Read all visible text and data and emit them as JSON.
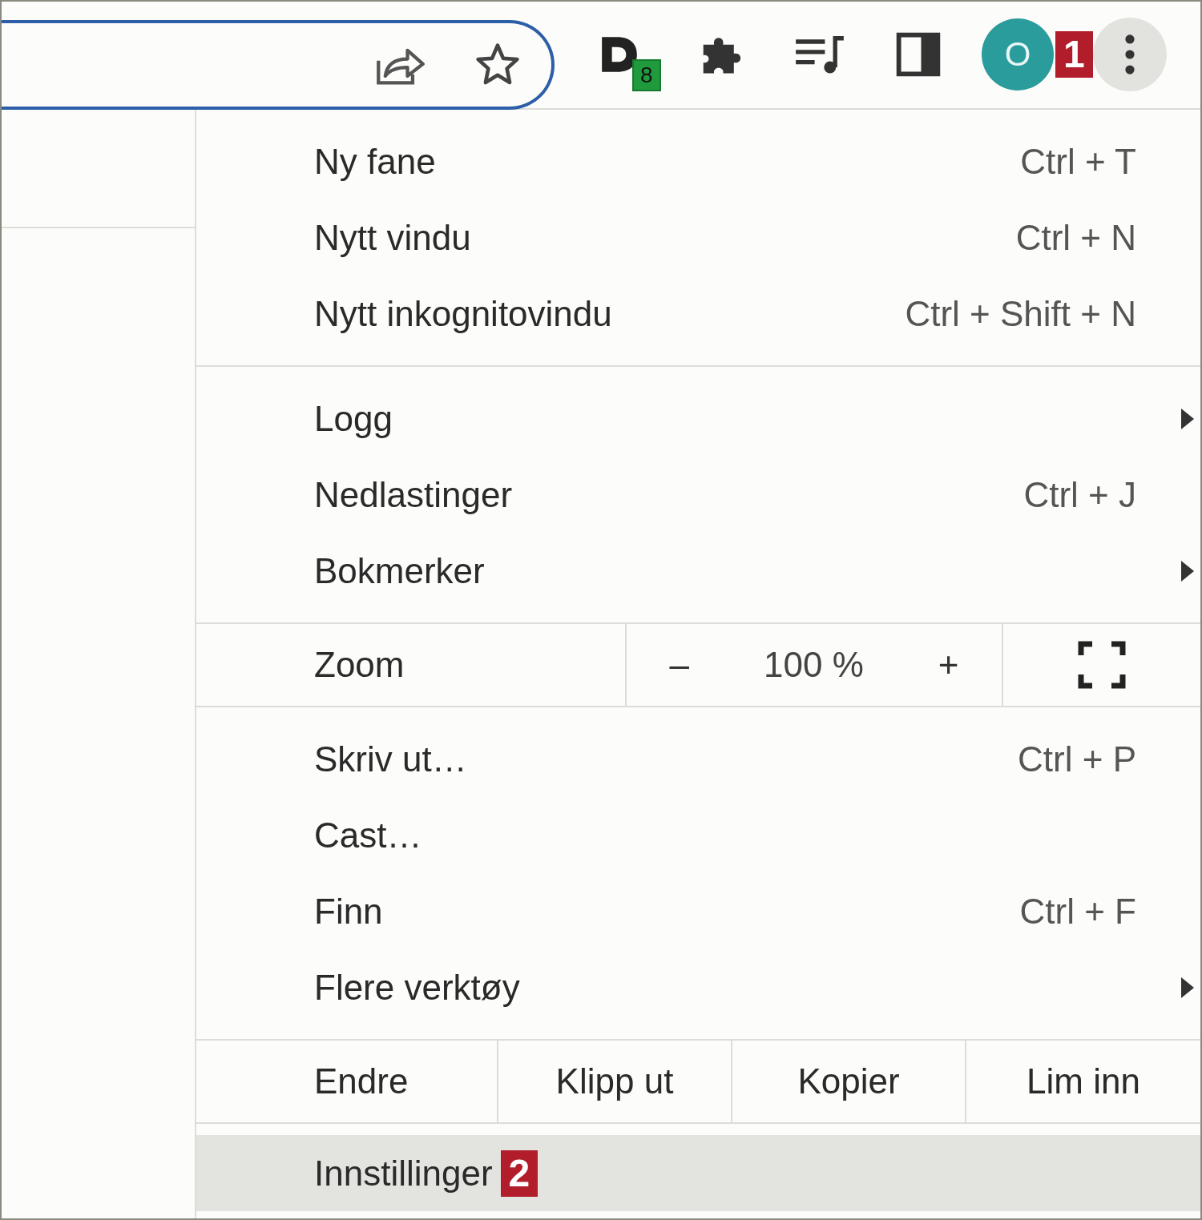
{
  "toolbar": {
    "extension_badge": "8",
    "profile_initial": "O",
    "step_badge": "1"
  },
  "menu": {
    "groups": [
      {
        "kind": "items",
        "items": [
          {
            "label": "Ny fane",
            "shortcut": "Ctrl + T",
            "submenu": false,
            "selected": false
          },
          {
            "label": "Nytt vindu",
            "shortcut": "Ctrl + N",
            "submenu": false,
            "selected": false
          },
          {
            "label": "Nytt inkognitovindu",
            "shortcut": "Ctrl + Shift + N",
            "submenu": false,
            "selected": false
          }
        ]
      },
      {
        "kind": "items",
        "items": [
          {
            "label": "Logg",
            "submenu": true,
            "selected": false
          },
          {
            "label": "Nedlastinger",
            "shortcut": "Ctrl + J",
            "submenu": false,
            "selected": false
          },
          {
            "label": "Bokmerker",
            "submenu": true,
            "selected": false
          }
        ]
      },
      {
        "kind": "zoom",
        "label": "Zoom",
        "minus": "–",
        "value": "100 %",
        "plus": "+"
      },
      {
        "kind": "items",
        "items": [
          {
            "label": "Skriv ut…",
            "shortcut": "Ctrl + P",
            "submenu": false,
            "selected": false
          },
          {
            "label": "Cast…",
            "submenu": false,
            "selected": false
          },
          {
            "label": "Finn",
            "shortcut": "Ctrl + F",
            "submenu": false,
            "selected": false
          },
          {
            "label": "Flere verktøy",
            "submenu": true,
            "selected": false
          }
        ]
      },
      {
        "kind": "edit",
        "label": "Endre",
        "actions": [
          "Klipp ut",
          "Kopier",
          "Lim inn"
        ]
      },
      {
        "kind": "items",
        "items": [
          {
            "label": "Innstillinger",
            "badge": "2",
            "submenu": false,
            "selected": true
          }
        ]
      }
    ]
  }
}
